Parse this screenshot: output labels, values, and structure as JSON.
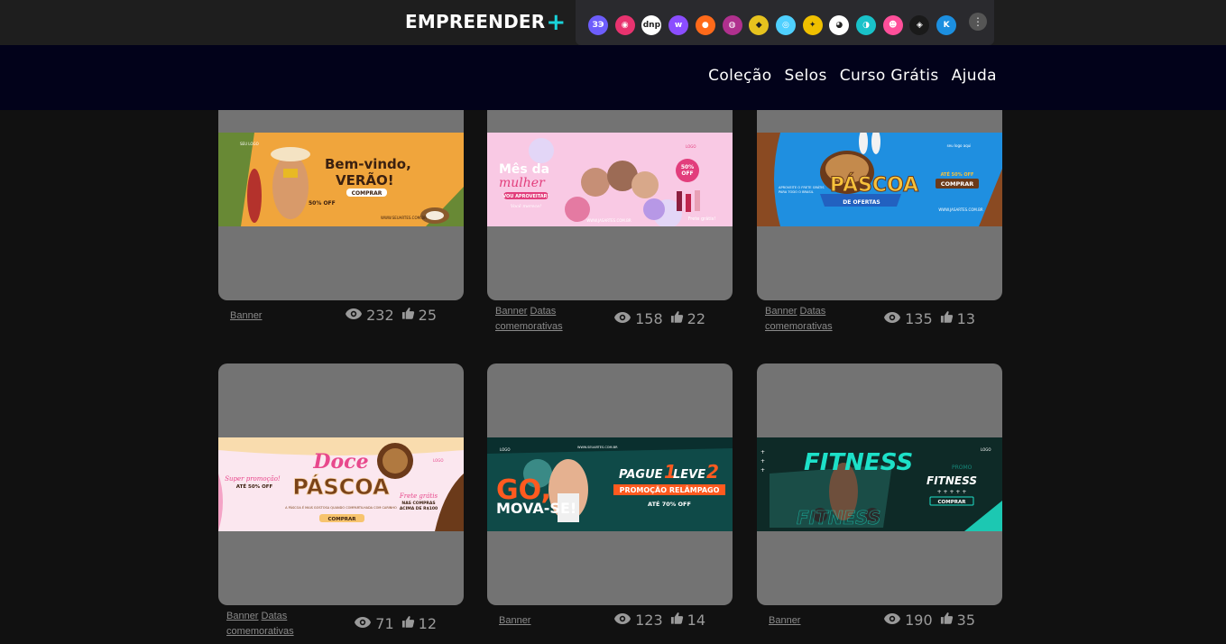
{
  "brand": {
    "name": "EMPREENDER",
    "plus": "+"
  },
  "apps": [
    {
      "icon": "app-icon-1",
      "color": "#6d5dfc",
      "glyph": "ЗЭ"
    },
    {
      "icon": "app-icon-2",
      "color": "#e8336f",
      "glyph": "◉"
    },
    {
      "icon": "app-icon-3",
      "color": "#ffffff",
      "glyph": "dnp"
    },
    {
      "icon": "app-icon-4",
      "color": "#8b4dff",
      "glyph": "w"
    },
    {
      "icon": "app-icon-5",
      "color": "#ff6a1a",
      "glyph": "●"
    },
    {
      "icon": "app-icon-6",
      "color": "#b0308e",
      "glyph": "◍"
    },
    {
      "icon": "app-icon-7",
      "color": "#e6c21e",
      "glyph": "◆"
    },
    {
      "icon": "app-icon-8",
      "color": "#4fd0ff",
      "glyph": "◎"
    },
    {
      "icon": "app-icon-9",
      "color": "#f0c000",
      "glyph": "✦"
    },
    {
      "icon": "app-icon-10",
      "color": "#ffffff",
      "glyph": "◕"
    },
    {
      "icon": "app-icon-11",
      "color": "#19c2c9",
      "glyph": "◑"
    },
    {
      "icon": "app-icon-12",
      "color": "#ff4f9a",
      "glyph": "☻"
    },
    {
      "icon": "app-icon-13",
      "color": "#1a1a1a",
      "glyph": "◈"
    },
    {
      "icon": "app-icon-14",
      "color": "#1c8fe0",
      "glyph": "K"
    }
  ],
  "apps_more": "⋮",
  "nav": [
    "Coleção",
    "Selos",
    "Curso Grátis",
    "Ajuda"
  ],
  "cards": [
    {
      "tags": [
        "Banner"
      ],
      "views": "232",
      "likes": "25",
      "banner": {
        "bg": "#f0a53c",
        "title": "Bem-vindo, VERÃO!",
        "button": "COMPRAR",
        "badge": "50% OFF",
        "label": "SEU LOGO",
        "url": "WWW.SEUARTES.COM.BR"
      }
    },
    {
      "tags": [
        "Banner",
        "Datas comemorativas"
      ],
      "views": "158",
      "likes": "22",
      "banner": {
        "bg": "#f9c9e4",
        "title": "Mês da mulher",
        "button": "VOU APROVEITAR!",
        "badge": "50% OFF",
        "label": "LOGO",
        "url": "WWW.JASARTES.COM.BR",
        "extra": "Frete grátis!",
        "cursive": "Você merece!"
      }
    },
    {
      "tags": [
        "Banner",
        "Datas comemorativas"
      ],
      "views": "135",
      "likes": "13",
      "banner": {
        "bg": "#1f8fe0",
        "title": "PÁSCOA",
        "subtitle": "DE OFERTAS",
        "button": "COMPRAR",
        "badge": "ATÉ 50% OFF",
        "label": "seu logo aqui",
        "url": "WWW.JASARTES.COM.BR",
        "extra": "APROVEITE O FRETE GRÁTIS PARA TODO O BRASIL"
      }
    },
    {
      "tags": [
        "Banner",
        "Datas comemorativas"
      ],
      "views": "71",
      "likes": "12",
      "banner": {
        "bg": "#fbe7ef",
        "title": "Doce PÁSCOA",
        "button": "COMPRAR",
        "badge": "ATÉ 50% OFF",
        "label": "LOGO",
        "cursive": "Super promoção!",
        "extra": "Frete grátis NAS COMPRAS ACIMA DE R$100",
        "sub": "A PÁSCOA É MAIS GOSTOSA QUANDO COMPARTILHADA COM CARINHO"
      }
    },
    {
      "tags": [
        "Banner"
      ],
      "views": "123",
      "likes": "14",
      "banner": {
        "bg": "#0f4a48",
        "title": "GO, MOVA-SE!",
        "button": "ATÉ 70% OFF",
        "badge": "PAGUE 1 LEVE 2",
        "label": "LOGO",
        "url": "WWW.SEUARTES.COM.BR",
        "extra": "PROMOÇÃO RELÂMPAGO"
      }
    },
    {
      "tags": [
        "Banner"
      ],
      "views": "190",
      "likes": "35",
      "banner": {
        "bg": "#0c1e1d",
        "title": "FITNESS",
        "button": "COMPRAR",
        "badge": "FITNESS",
        "label": "LOGO",
        "sub": "PROMO"
      }
    }
  ]
}
